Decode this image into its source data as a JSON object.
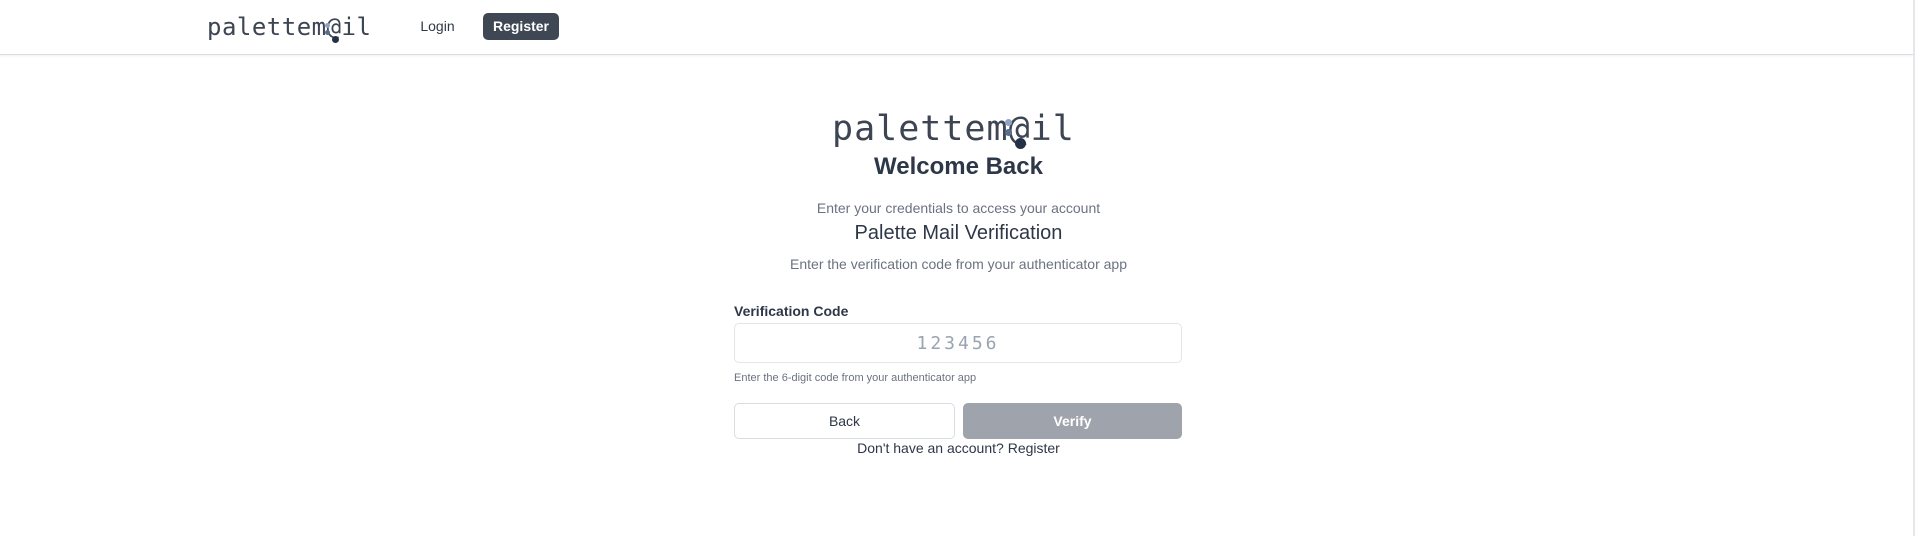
{
  "nav": {
    "logo": {
      "prefix": "palettem",
      "at": "@",
      "suffix": "il"
    },
    "login_label": "Login",
    "register_label": "Register"
  },
  "main": {
    "logo": {
      "prefix": "palettem",
      "at": "@",
      "suffix": "il"
    },
    "welcome_title": "Welcome Back",
    "subtitle": "Enter your credentials to access your account",
    "verification_title": "Palette Mail Verification",
    "verification_subtitle": "Enter the verification code from your authenticator app",
    "code_field": {
      "label": "Verification Code",
      "placeholder": "123456",
      "value": "",
      "hint": "Enter the 6-digit code from your authenticator app"
    },
    "back_label": "Back",
    "verify_label": "Verify",
    "footer_text": "Don't have an account?",
    "footer_link": "Register"
  },
  "colors": {
    "text_dark": "#2d3748",
    "text_muted": "#6b7280",
    "nav_button": "#3f4654",
    "verify_disabled": "#9fa3ab",
    "logo_dot_light": "#8fa3c7",
    "logo_dot_dark": "#233047"
  }
}
